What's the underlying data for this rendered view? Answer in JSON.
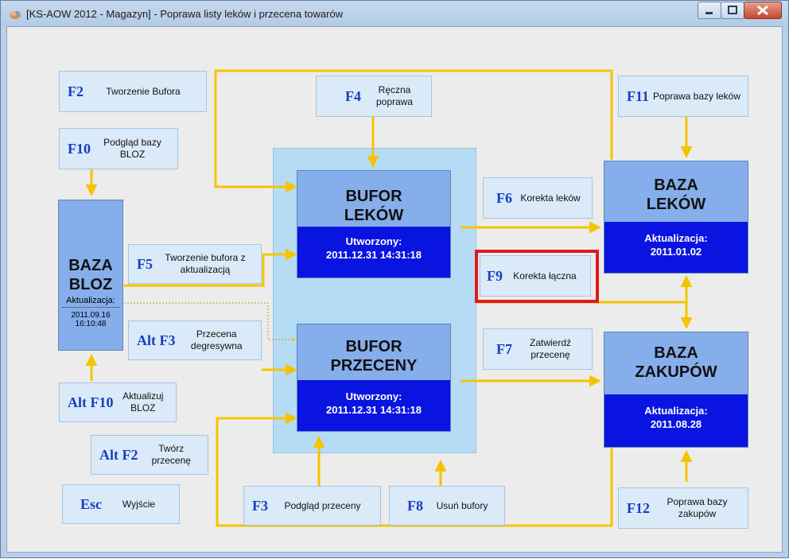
{
  "window": {
    "title": "[KS-AOW 2012 - Magazyn] - Poprawa listy leków i przecena towarów"
  },
  "icons": {
    "app": "app-icon",
    "minimize": "minimize-icon",
    "maximize": "maximize-icon",
    "close": "close-icon"
  },
  "colors": {
    "accent_dark_blue": "#0a14e0",
    "box_blue": "#86aeeb",
    "panel_light_blue": "#b5dcf4",
    "arrow_yellow": "#f5c400",
    "highlight_red": "#e0191e",
    "fkey_text": "#1540c0"
  },
  "fkeys": {
    "f2": {
      "key": "F2",
      "desc": "Tworzenie Bufora"
    },
    "f10": {
      "key": "F10",
      "desc": "Podgląd bazy BLOZ"
    },
    "f5": {
      "key": "F5",
      "desc": "Tworzenie bufora z aktualizacją"
    },
    "altf3": {
      "key": "Alt F3",
      "desc": "Przecena degresywna"
    },
    "altf10": {
      "key": "Alt F10",
      "desc": "Aktualizuj BLOZ"
    },
    "altf2": {
      "key": "Alt F2",
      "desc": "Twórz przecenę"
    },
    "esc": {
      "key": "Esc",
      "desc": "Wyjście"
    },
    "f4": {
      "key": "F4",
      "desc": "Ręczna poprawa"
    },
    "f3": {
      "key": "F3",
      "desc": "Podgląd przeceny"
    },
    "f8": {
      "key": "F8",
      "desc": "Usuń bufory"
    },
    "f6": {
      "key": "F6",
      "desc": "Korekta leków"
    },
    "f9": {
      "key": "F9",
      "desc": "Korekta łączna"
    },
    "f7": {
      "key": "F7",
      "desc": "Zatwierdź przecenę"
    },
    "f11": {
      "key": "F11",
      "desc": "Poprawa bazy leków"
    },
    "f12": {
      "key": "F12",
      "desc": "Poprawa bazy zakupów"
    }
  },
  "boxes": {
    "bloz": {
      "title1": "BAZA",
      "title2": "BLOZ",
      "sub": "Aktualizacja:",
      "date": "2011.09.16",
      "time": "16:10:48"
    },
    "bufor_lekow": {
      "title1": "BUFOR",
      "title2": "LEKÓW",
      "label": "Utworzony:",
      "date": "2011.12.31 14:31:18"
    },
    "bufor_przeceny": {
      "title1": "BUFOR",
      "title2": "PRZECENY",
      "label": "Utworzony:",
      "date": "2011.12.31 14:31:18"
    },
    "baza_lekow": {
      "title1": "BAZA",
      "title2": "LEKÓW",
      "label": "Aktualizacja:",
      "date": "2011.01.02"
    },
    "baza_zakupow": {
      "title1": "BAZA",
      "title2": "ZAKUPÓW",
      "label": "Aktualizacja:",
      "date": "2011.08.28"
    }
  }
}
